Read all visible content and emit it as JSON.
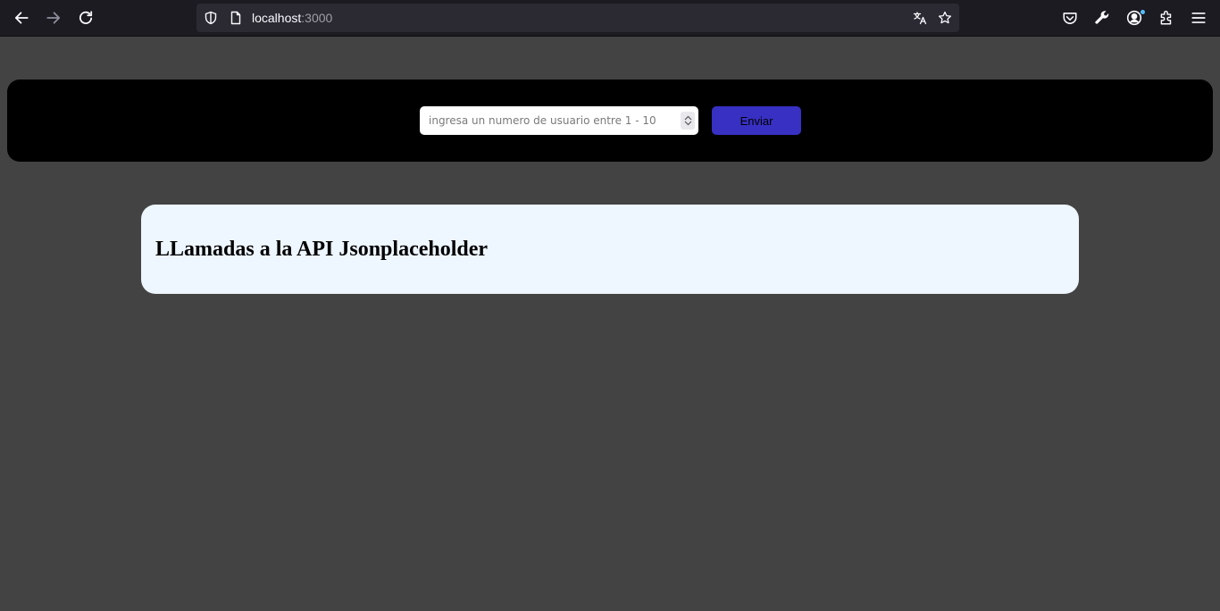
{
  "browser": {
    "url_host": "localhost",
    "url_port": ":3000",
    "icons": {
      "back": "back-arrow-icon",
      "forward": "forward-arrow-icon",
      "reload": "reload-icon",
      "tracking_protection": "shield-icon",
      "page_info": "page-icon",
      "translate": "translate-icon",
      "bookmark": "star-icon",
      "pocket": "pocket-icon",
      "devtools": "wrench-icon",
      "account": "account-icon",
      "extensions": "puzzle-icon",
      "menu": "hamburger-menu-icon"
    },
    "colors": {
      "toolbar": "#1c1b22",
      "urlbar": "#2b2a33",
      "notify_dot": "#54c0ff"
    }
  },
  "header": {
    "input_placeholder": "ingresa un numero de usuario entre 1 - 10",
    "input_value": "",
    "submit_label": "Enviar",
    "colors": {
      "bar": "#000000",
      "button": "#3730c2"
    }
  },
  "main": {
    "title": "LLamadas a la API Jsonplaceholder",
    "colors": {
      "card": "#eef6ff",
      "page_bg": "#434343"
    }
  }
}
